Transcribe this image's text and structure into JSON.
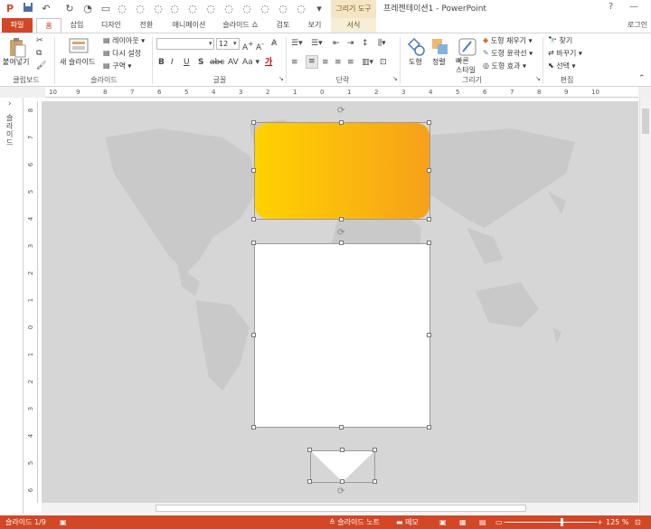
{
  "titlebar": {
    "context_tab_title": "그리기 도구",
    "window_title": "프레젠테이션1 - PowerPoint",
    "help": "?",
    "minimize": "—"
  },
  "tabs": {
    "file": "파일",
    "items": [
      "홈",
      "삽입",
      "디자인",
      "전환",
      "애니메이션",
      "슬라이드 쇼",
      "검토",
      "보기",
      "서식"
    ],
    "login": "로그인"
  },
  "ribbon": {
    "clipboard": {
      "paste": "붙여넣기",
      "label": "클립보드"
    },
    "slides": {
      "new_slide": "새 슬라이드",
      "layout": "레이아웃",
      "reset": "다시 설정",
      "section": "구역",
      "label": "슬라이드"
    },
    "font": {
      "font_name": "",
      "font_size": "12",
      "label": "글꼴",
      "aa": "Aa"
    },
    "paragraph": {
      "label": "단락"
    },
    "drawing": {
      "shape": "도형",
      "arrange": "정렬",
      "quick_styles": "빠른\n스타일",
      "fill": "도형 채우기",
      "outline": "도형 윤곽선",
      "effects": "도형 효과",
      "label": "그리기"
    },
    "editing": {
      "find": "찾기",
      "replace": "바꾸기",
      "select": "선택",
      "label": "편집"
    }
  },
  "side_panel": {
    "label": "슬라이드"
  },
  "ruler": {
    "h_ticks": [
      "10",
      "9",
      "8",
      "7",
      "6",
      "5",
      "4",
      "3",
      "2",
      "1",
      "0",
      "1",
      "2",
      "3",
      "4",
      "5",
      "6",
      "7",
      "8",
      "9",
      "10"
    ],
    "v_ticks": [
      "8",
      "7",
      "6",
      "5",
      "4",
      "3",
      "2",
      "1",
      "0",
      "1",
      "2",
      "3",
      "4",
      "5",
      "6"
    ]
  },
  "status": {
    "slide_info": "슬라이드 1/9",
    "notes": "슬라이드 노트",
    "comments": "메모",
    "zoom": "125 %"
  },
  "colors": {
    "accent": "#d24726",
    "gradient_start": "#ffd200",
    "gradient_end": "#f7a11a",
    "map": "#c9c9c9"
  }
}
